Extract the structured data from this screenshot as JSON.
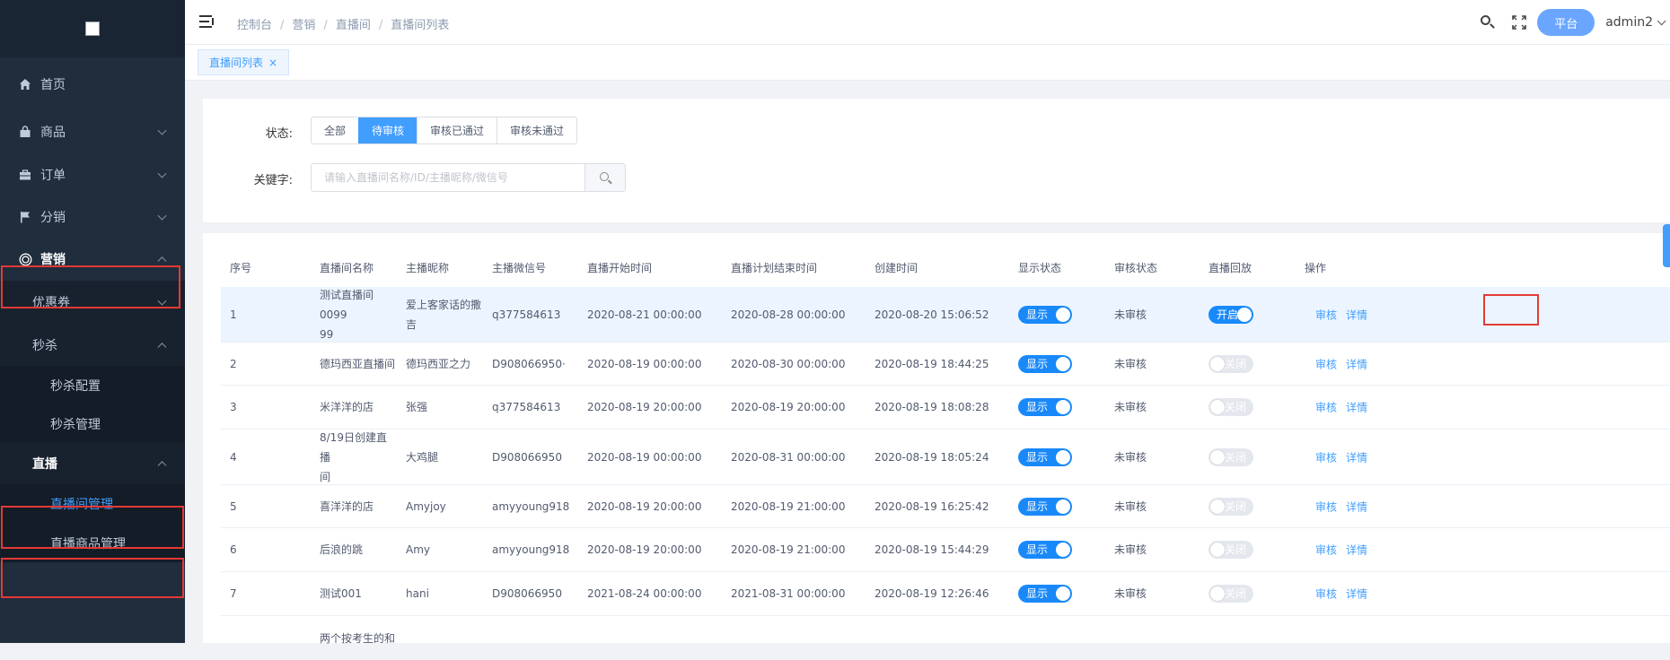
{
  "sidebar": {
    "menu": [
      {
        "label": "首页",
        "icon": "home-icon"
      },
      {
        "label": "商品",
        "icon": "bag-icon"
      },
      {
        "label": "订单",
        "icon": "briefcase-icon"
      },
      {
        "label": "分销",
        "icon": "flag-icon"
      },
      {
        "label": "营销",
        "icon": "target-icon"
      }
    ],
    "marketing_sub": [
      {
        "label": "优惠券"
      },
      {
        "label": "秒杀"
      }
    ],
    "seckill_sub": [
      {
        "label": "秒杀配置"
      },
      {
        "label": "秒杀管理"
      }
    ],
    "live": {
      "label": "直播"
    },
    "live_sub": [
      {
        "label": "直播间管理"
      },
      {
        "label": "直播商品管理"
      }
    ]
  },
  "header": {
    "breadcrumb": [
      "控制台",
      "营销",
      "直播间",
      "直播间列表"
    ],
    "platform_label": "平台",
    "user_name": "admin2"
  },
  "tabs": {
    "active_label": "直播间列表"
  },
  "filters": {
    "status_label": "状态:",
    "status_options": [
      "全部",
      "待审核",
      "审核已通过",
      "审核未通过"
    ],
    "keyword_label": "关键字:",
    "keyword_placeholder": "请输入直播间名称/ID/主播昵称/微信号"
  },
  "table": {
    "columns": [
      "序号",
      "直播间名称",
      "主播昵称",
      "主播微信号",
      "直播开始时间",
      "直播计划结束时间",
      "创建时间",
      "显示状态",
      "审核状态",
      "直播回放",
      "操作"
    ],
    "show_on_label": "显示",
    "replay_on_label": "开启",
    "replay_off_label": "关闭",
    "review_action": "审核",
    "detail_action": "详情",
    "rows": [
      {
        "index": "1",
        "name": "测试直播间 0099\n99",
        "anchor": "爱上客家话的撒\n吉",
        "wechat": "q377584613",
        "start": "2020-08-21 00:00:00",
        "end": "2020-08-28 00:00:00",
        "created": "2020-08-20 15:06:52",
        "show": true,
        "review": "未审核",
        "replay": true
      },
      {
        "index": "2",
        "name": "德玛西亚直播间",
        "anchor": "德玛西亚之力",
        "wechat": "D908066950·",
        "start": "2020-08-19 00:00:00",
        "end": "2020-08-30 00:00:00",
        "created": "2020-08-19 18:44:25",
        "show": true,
        "review": "未审核",
        "replay": false
      },
      {
        "index": "3",
        "name": "米洋洋的店",
        "anchor": "张强",
        "wechat": "q377584613",
        "start": "2020-08-19 20:00:00",
        "end": "2020-08-19 20:00:00",
        "created": "2020-08-19 18:08:28",
        "show": true,
        "review": "未审核",
        "replay": false
      },
      {
        "index": "4",
        "name": "8/19日创建直播\n间",
        "anchor": "大鸡腿",
        "wechat": "D908066950",
        "start": "2020-08-19 00:00:00",
        "end": "2020-08-31 00:00:00",
        "created": "2020-08-19 18:05:24",
        "show": true,
        "review": "未审核",
        "replay": false
      },
      {
        "index": "5",
        "name": "喜洋洋的店",
        "anchor": "Amyjoy",
        "wechat": "amyyoung918",
        "start": "2020-08-19 20:00:00",
        "end": "2020-08-19 21:00:00",
        "created": "2020-08-19 16:25:42",
        "show": true,
        "review": "未审核",
        "replay": false
      },
      {
        "index": "6",
        "name": "后浪的跳",
        "anchor": "Amy",
        "wechat": "amyyoung918",
        "start": "2020-08-19 20:00:00",
        "end": "2020-08-19 21:00:00",
        "created": "2020-08-19 15:44:29",
        "show": true,
        "review": "未审核",
        "replay": false
      },
      {
        "index": "7",
        "name": "测试001",
        "anchor": "hani",
        "wechat": "D908066950",
        "start": "2021-08-24 00:00:00",
        "end": "2021-08-31 00:00:00",
        "created": "2020-08-19 12:26:46",
        "show": true,
        "review": "未审核",
        "replay": false
      },
      {
        "index": "",
        "name": "两个按考生的和",
        "anchor": "",
        "wechat": "",
        "start": "",
        "end": "",
        "created": "",
        "show": null,
        "review": "",
        "replay": null
      }
    ]
  }
}
